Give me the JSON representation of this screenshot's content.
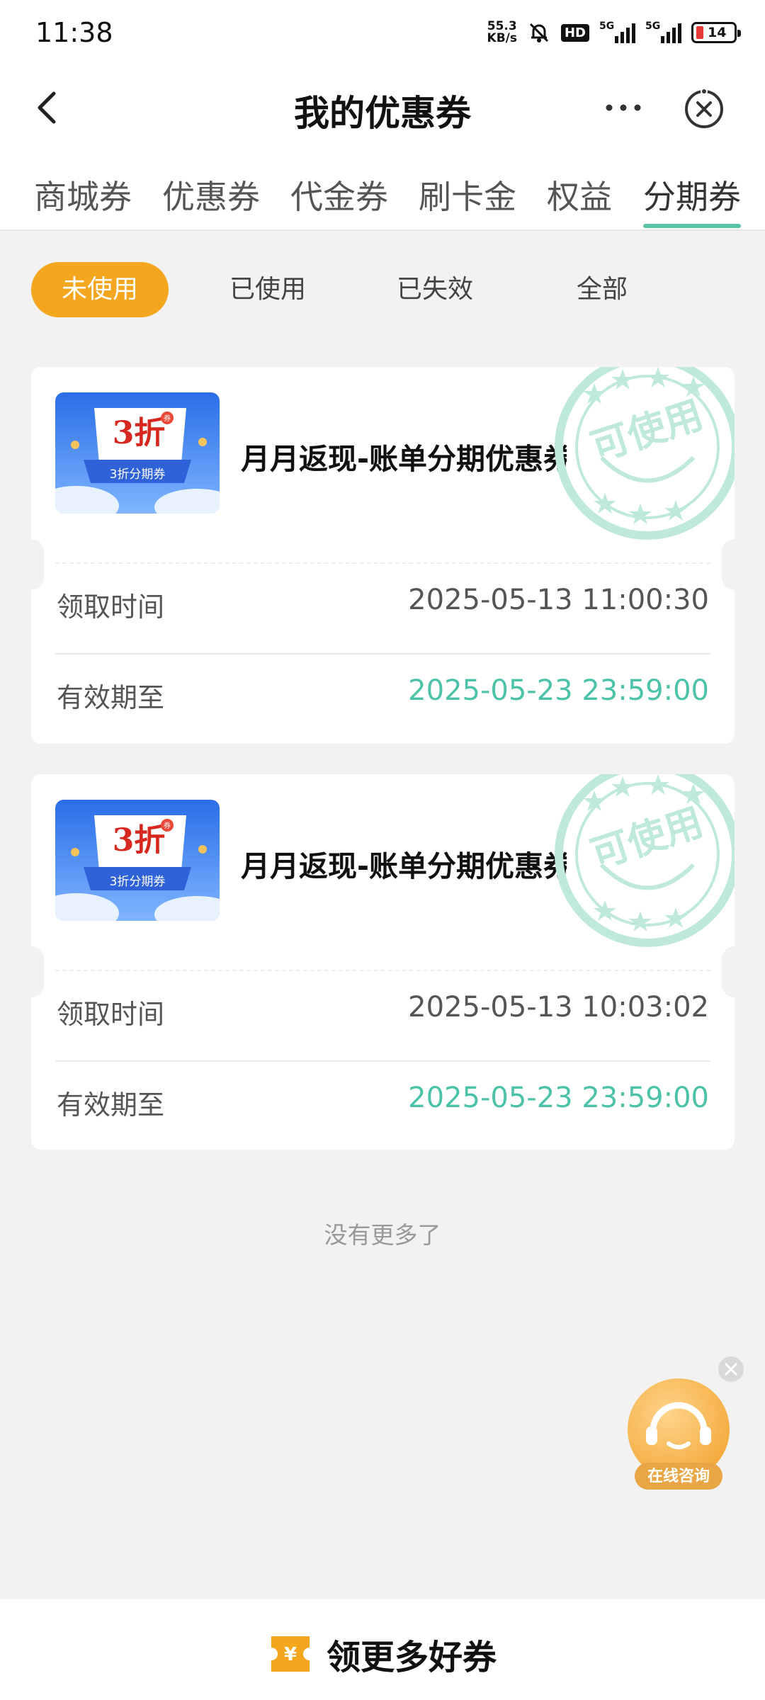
{
  "status_bar": {
    "time": "11:38",
    "net_speed_value": "55.3",
    "net_speed_unit": "KB/s",
    "hd_label": "HD",
    "network_1": "5G",
    "network_2": "5G",
    "battery_level": "14"
  },
  "header": {
    "title": "我的优惠券"
  },
  "tabs": [
    {
      "label": "商城券",
      "active": false
    },
    {
      "label": "优惠券",
      "active": false
    },
    {
      "label": "代金券",
      "active": false
    },
    {
      "label": "刷卡金",
      "active": false
    },
    {
      "label": "权益",
      "active": false
    },
    {
      "label": "分期券",
      "active": true
    }
  ],
  "filters": [
    {
      "label": "未使用",
      "active": true
    },
    {
      "label": "已使用",
      "active": false
    },
    {
      "label": "已失效",
      "active": false
    },
    {
      "label": "全部",
      "active": false
    }
  ],
  "coupons": [
    {
      "thumb_big": "3折",
      "thumb_badge": "券",
      "thumb_caption": "3折分期券",
      "name": "月月返现-账单分期优惠券",
      "stamp": "可使用",
      "received_label": "领取时间",
      "received_time": "2025-05-13 11:00:30",
      "expiry_label": "有效期至",
      "expiry_time": "2025-05-23 23:59:00"
    },
    {
      "thumb_big": "3折",
      "thumb_badge": "券",
      "thumb_caption": "3折分期券",
      "name": "月月返现-账单分期优惠券",
      "stamp": "可使用",
      "received_label": "领取时间",
      "received_time": "2025-05-13 10:03:02",
      "expiry_label": "有效期至",
      "expiry_time": "2025-05-23 23:59:00"
    }
  ],
  "list_end_text": "没有更多了",
  "float_service": {
    "label": "在线咨询"
  },
  "bottom_bar": {
    "icon_text": "¥",
    "label": "领更多好券"
  },
  "colors": {
    "accent_teal": "#57c4a8",
    "filter_active": "#f3a61e",
    "expiry_text": "#4cc3a8"
  }
}
